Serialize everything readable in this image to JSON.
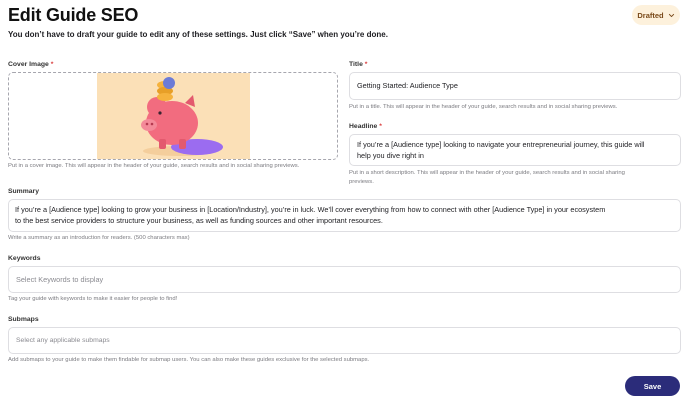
{
  "header": {
    "title": "Edit Guide SEO",
    "status": "Drafted",
    "subtitle": "You don’t have to draft your guide to edit any of these settings. Just click “Save” when you’re done."
  },
  "cover_image": {
    "label": "Cover Image",
    "required_mark": "*",
    "helper": "Put in a cover image. This will appear in the header of your guide, search results  and in social sharing previews."
  },
  "title_field": {
    "label": "Title",
    "required_mark": "*",
    "value": "Getting Started: Audience Type",
    "helper": "Put in a title. This will appear in the header of your guide, search results  and in social sharing previews."
  },
  "headline_field": {
    "label": "Headline",
    "required_mark": "*",
    "value_line1": "If you’re a [Audience type] looking to navigate your entrepreneurial journey, this guide will",
    "value_line2": "help you dive right in",
    "helper_line1": "Put in a short description. This will appear in the header of your guide, search results and in social sharing",
    "helper_line2": "previews."
  },
  "summary_field": {
    "label": "Summary",
    "value_line1": "If you’re a [Audience type] looking to grow your business in [Location/Industry], you’re in luck. We’ll cover everything from how to connect with other [Audience Type] in your ecosystem",
    "value_line2": "to the best service providers to structure your business, as well as funding sources and other important resources.",
    "helper": "Write a summary as an introduction for readers. (500 characters max)"
  },
  "keywords_field": {
    "label": "Keywords",
    "placeholder": "Select Keywords to display",
    "helper": "Tag your guide with keywords to make it easier for people to find!"
  },
  "submaps_field": {
    "label": "Submaps",
    "placeholder": "Select any applicable submaps",
    "helper": "Add submaps to your guide to make them findable for submap users. You can also make these guides exclusive for the selected submaps."
  },
  "actions": {
    "save_label": "Save"
  },
  "colors": {
    "primary_button": "#2b2c7a",
    "status_pill_bg": "#fdf1dc",
    "required": "#d93a3a",
    "cover_bg": "#fbe0b7",
    "piggy": "#f26c7f"
  },
  "icons": {
    "status_dropdown": "chevron-down-icon",
    "cover_illustration": "piggy-bank-illustration"
  }
}
